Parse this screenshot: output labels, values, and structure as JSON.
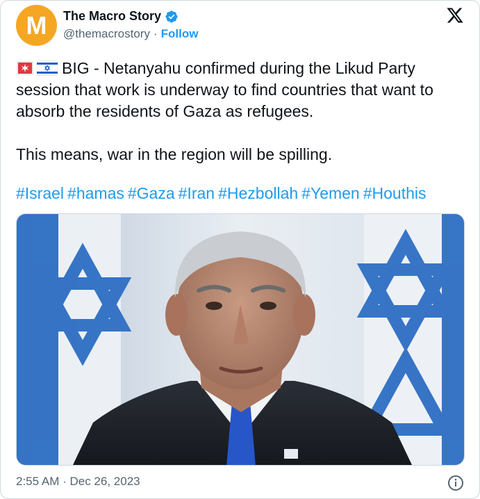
{
  "author": {
    "avatar_letter": "M",
    "name": "The Macro Story",
    "handle": "@themacrostory",
    "separator": "·",
    "follow_label": "Follow"
  },
  "tweet": {
    "line1": "BIG - Netanyahu confirmed during the Likud Party session that work is underway to find countries that want to absorb the residents of Gaza as refugees.",
    "line2": "This means, war in the region will be spilling.",
    "hashtags": [
      "#Israel",
      "#hamas",
      "#Gaza",
      "#Iran",
      "#Hezbollah",
      "#Yemen",
      "#Houthis"
    ]
  },
  "footer": {
    "timestamp": "2:55 AM · Dec 26, 2023"
  },
  "icons": {
    "logo": "x-logo-icon",
    "verified": "verified-badge-icon",
    "info": "info-icon",
    "siren": "siren-emoji-icon",
    "flag": "israel-flag-emoji-icon"
  },
  "colors": {
    "accent": "#1d9bf0",
    "avatar": "#f5a623",
    "muted": "#536471",
    "text": "#0f1419"
  }
}
